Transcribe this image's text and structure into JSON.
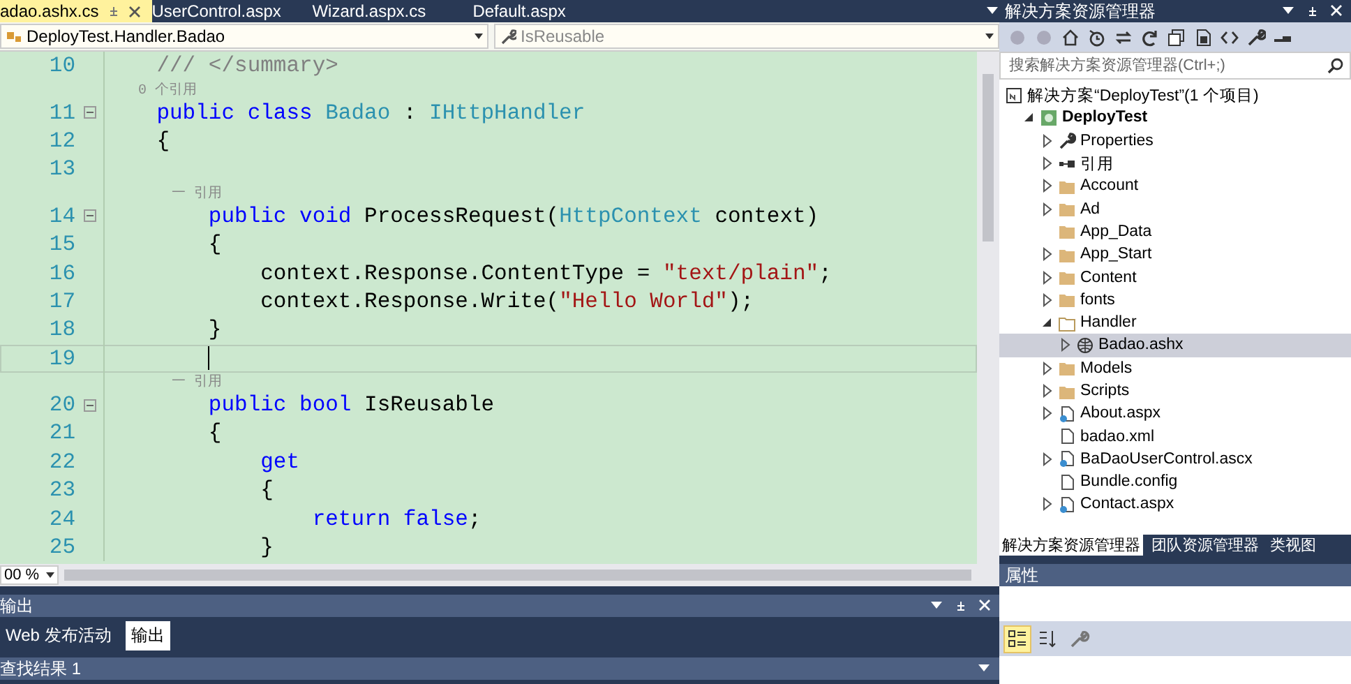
{
  "editor_tabs": [
    {
      "label": "adao.ashx.cs",
      "selected": true
    },
    {
      "label": "UserControl.aspx",
      "selected": false
    },
    {
      "label": "Wizard.aspx.cs",
      "selected": false
    },
    {
      "label": "Default.aspx",
      "selected": false
    }
  ],
  "nav_bar": {
    "type_selector": "DeployTest.Handler.Badao",
    "member_selector": "IsReusable"
  },
  "code_lines": [
    {
      "kind": "code",
      "number": "10",
      "fold": false,
      "current": false,
      "tokens": [
        {
          "t": "    /// </summary>",
          "kind": "comment"
        }
      ]
    },
    {
      "kind": "lens",
      "text": "    0 个引用"
    },
    {
      "kind": "code",
      "number": "11",
      "fold": true,
      "current": false,
      "tokens": [
        {
          "t": "    public class",
          "kind": "keyword"
        },
        {
          "t": " Badao",
          "kind": "type"
        },
        {
          "t": " : ",
          "kind": "plain"
        },
        {
          "t": "IHttpHandler",
          "kind": "type"
        }
      ]
    },
    {
      "kind": "code",
      "number": "12",
      "fold": false,
      "current": false,
      "tokens": [
        {
          "t": "    {",
          "kind": "plain"
        }
      ]
    },
    {
      "kind": "code",
      "number": "13",
      "fold": false,
      "current": false
    },
    {
      "kind": "lens",
      "text": "        一 引用"
    },
    {
      "kind": "code",
      "number": "14",
      "fold": true,
      "current": false,
      "tokens": [
        {
          "t": "        public void",
          "kind": "keyword"
        },
        {
          "t": " ProcessRequest(",
          "kind": "plain"
        },
        {
          "t": "HttpContext",
          "kind": "type"
        },
        {
          "t": " context)",
          "kind": "plain"
        }
      ]
    },
    {
      "kind": "code",
      "number": "15",
      "fold": false,
      "current": false,
      "tokens": [
        {
          "t": "        {",
          "kind": "plain"
        }
      ]
    },
    {
      "kind": "code",
      "number": "16",
      "fold": false,
      "current": false,
      "tokens": [
        {
          "t": "            context.Response.ContentType = ",
          "kind": "plain"
        },
        {
          "t": "\"text/plain\"",
          "kind": "string"
        },
        {
          "t": ";",
          "kind": "plain"
        }
      ]
    },
    {
      "kind": "code",
      "number": "17",
      "fold": false,
      "current": false,
      "tokens": [
        {
          "t": "            context.Response.Write(",
          "kind": "plain"
        },
        {
          "t": "\"Hello World\"",
          "kind": "string"
        },
        {
          "t": ");",
          "kind": "plain"
        }
      ]
    },
    {
      "kind": "code",
      "number": "18",
      "fold": false,
      "current": false,
      "tokens": [
        {
          "t": "        }",
          "kind": "plain"
        }
      ]
    },
    {
      "kind": "code",
      "number": "19",
      "fold": false,
      "current": true
    },
    {
      "kind": "lens",
      "text": "        一 引用"
    },
    {
      "kind": "code",
      "number": "20",
      "fold": true,
      "current": false,
      "tokens": [
        {
          "t": "        public bool",
          "kind": "keyword"
        },
        {
          "t": " IsReusable",
          "kind": "plain"
        }
      ]
    },
    {
      "kind": "code",
      "number": "21",
      "fold": false,
      "current": false,
      "tokens": [
        {
          "t": "        {",
          "kind": "plain"
        }
      ]
    },
    {
      "kind": "code",
      "number": "22",
      "fold": false,
      "current": false,
      "tokens": [
        {
          "t": "            get",
          "kind": "keyword"
        }
      ]
    },
    {
      "kind": "code",
      "number": "23",
      "fold": false,
      "current": false,
      "tokens": [
        {
          "t": "            {",
          "kind": "plain"
        }
      ]
    },
    {
      "kind": "code",
      "number": "24",
      "fold": false,
      "current": false,
      "tokens": [
        {
          "t": "                return false",
          "kind": "keyword"
        },
        {
          "t": ";",
          "kind": "plain"
        }
      ]
    },
    {
      "kind": "code",
      "number": "25",
      "fold": false,
      "current": false,
      "tokens": [
        {
          "t": "            }",
          "kind": "plain"
        }
      ]
    }
  ],
  "zoom": "00 %",
  "output_panel": {
    "title": "输出",
    "tabs": [
      {
        "label": "Web 发布活动",
        "selected": false
      },
      {
        "label": "输出",
        "selected": true
      }
    ]
  },
  "find_results": {
    "title": "查找结果 1"
  },
  "solution_explorer": {
    "title": "解决方案资源管理器",
    "search": {
      "placeholder": "搜索解决方案资源管理器(Ctrl+;)"
    },
    "tree": [
      {
        "label": "解决方案“DeployTest”(1 个项目)",
        "kind": "solution",
        "bold": false,
        "selected": false,
        "children": [
          {
            "label": "DeployTest",
            "kind": "project",
            "bold": true,
            "selected": false,
            "expanded": true,
            "children": [
              {
                "label": "Properties",
                "kind": "properties",
                "bold": false,
                "selected": false,
                "expanded": false
              },
              {
                "label": "引用",
                "kind": "references",
                "bold": false,
                "selected": false,
                "expanded": false
              },
              {
                "label": "Account",
                "kind": "folder",
                "bold": false,
                "selected": false,
                "expanded": false
              },
              {
                "label": "Ad",
                "kind": "folder",
                "bold": false,
                "selected": false,
                "expanded": false
              },
              {
                "label": "App_Data",
                "kind": "folder",
                "bold": false,
                "selected": false
              },
              {
                "label": "App_Start",
                "kind": "folder",
                "bold": false,
                "selected": false,
                "expanded": false
              },
              {
                "label": "Content",
                "kind": "folder",
                "bold": false,
                "selected": false,
                "expanded": false
              },
              {
                "label": "fonts",
                "kind": "folder",
                "bold": false,
                "selected": false,
                "expanded": false
              },
              {
                "label": "Handler",
                "kind": "folder",
                "bold": false,
                "selected": false,
                "expanded": true,
                "children": [
                  {
                    "label": "Badao.ashx",
                    "kind": "handler",
                    "bold": false,
                    "selected": true,
                    "expanded": false
                  }
                ]
              },
              {
                "label": "Models",
                "kind": "folder",
                "bold": false,
                "selected": false,
                "expanded": false
              },
              {
                "label": "Scripts",
                "kind": "folder",
                "bold": false,
                "selected": false,
                "expanded": false
              },
              {
                "label": "About.aspx",
                "kind": "page",
                "bold": false,
                "selected": false,
                "expanded": false
              },
              {
                "label": "badao.xml",
                "kind": "file",
                "bold": false,
                "selected": false
              },
              {
                "label": "BaDaoUserControl.ascx",
                "kind": "page",
                "bold": false,
                "selected": false,
                "expanded": false
              },
              {
                "label": "Bundle.config",
                "kind": "file",
                "bold": false,
                "selected": false
              },
              {
                "label": "Contact.aspx",
                "kind": "page",
                "bold": false,
                "selected": false,
                "expanded": false
              }
            ]
          }
        ]
      }
    ],
    "tabs": [
      {
        "label": "解决方案资源管理器",
        "selected": true
      },
      {
        "label": "团队资源管理器",
        "selected": false
      },
      {
        "label": "类视图",
        "selected": false
      }
    ]
  },
  "properties": {
    "title": "属性"
  }
}
